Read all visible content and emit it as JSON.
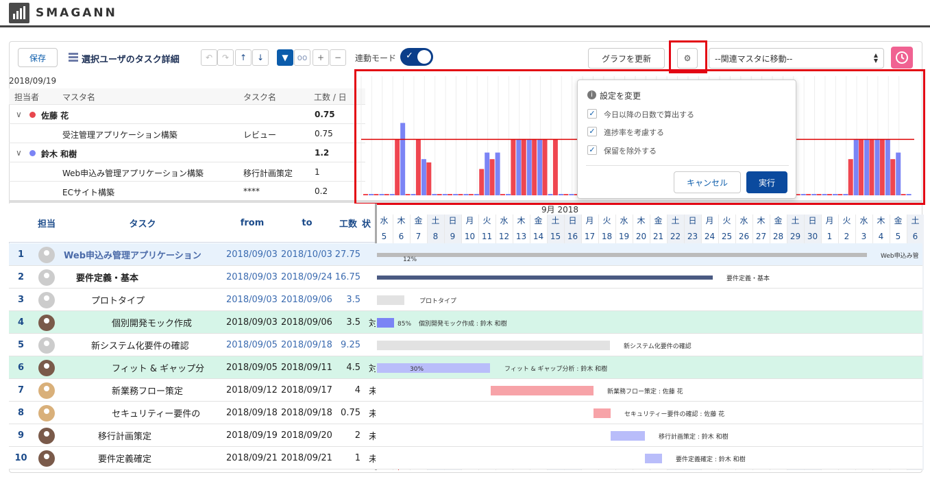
{
  "brand": {
    "name": "SMAGANN"
  },
  "toolbar": {
    "save_label": "保存",
    "title": "選択ユーザのタスク詳細",
    "sync_mode_label": "連動モード",
    "refresh_graph_label": "グラフを更新",
    "related_master_select": "--関連マスタに移動--"
  },
  "summary": {
    "date": "2018/09/19",
    "headers": [
      "担当者",
      "マスタ名",
      "タスク名",
      "工数 / 日"
    ],
    "rows": [
      {
        "type": "group",
        "name": "佐藤 花",
        "value": "0.75",
        "color": "#e8474e"
      },
      {
        "type": "item",
        "master": "受注管理アプリケーション構築",
        "task": "レビュー",
        "value": "0.75"
      },
      {
        "type": "group",
        "name": "鈴木 和樹",
        "value": "1.2",
        "color": "#7b84f5"
      },
      {
        "type": "item",
        "master": "Web申込み管理アプリケーション構築",
        "task": "移行計画策定",
        "value": "1"
      },
      {
        "type": "item",
        "master": "ECサイト構築",
        "task": "****",
        "value": "0.2"
      }
    ]
  },
  "settings_popup": {
    "title": "設定を変更",
    "options": [
      {
        "label": "今日以降の日数で算出する",
        "checked": true
      },
      {
        "label": "進捗率を考慮する",
        "checked": true
      },
      {
        "label": "保留を除外する",
        "checked": true
      }
    ],
    "cancel_label": "キャンセル",
    "execute_label": "実行"
  },
  "chart_data": {
    "type": "bar",
    "series": [
      {
        "values": [
          0,
          0,
          0,
          1.7,
          0,
          1.7,
          1.0,
          0,
          0,
          0,
          0,
          0.8,
          1.1,
          0,
          1.7,
          1.7,
          1.7,
          1.7,
          1.7,
          0,
          0,
          0,
          0,
          0,
          0,
          0,
          0,
          0,
          0,
          0,
          0,
          0,
          0,
          0,
          0,
          0,
          0,
          0,
          0,
          0,
          0,
          0,
          0,
          0,
          0,
          0,
          1.1,
          1.7,
          1.7,
          1.7,
          1.1,
          0
        ]
      },
      {
        "values": [
          0,
          0,
          0,
          2.2,
          0,
          1.1,
          0,
          0,
          0,
          0,
          0,
          1.3,
          1.3,
          0,
          1.7,
          1.7,
          1.7,
          0,
          0,
          0,
          0,
          0,
          0,
          0,
          0,
          0,
          0,
          0,
          0,
          0,
          0,
          0,
          0,
          0,
          0,
          0,
          0,
          0,
          0,
          0,
          0,
          0,
          0,
          0,
          0,
          0,
          1.7,
          1.7,
          1.7,
          1.7,
          1.3,
          0
        ]
      }
    ],
    "threshold": 1.7,
    "xlabel": "9月 2018"
  },
  "gantt": {
    "headers": [
      "担当",
      "タスク",
      "from",
      "to",
      "工数",
      "状"
    ],
    "month_label": "9月 2018",
    "days": [
      "水",
      "木",
      "金",
      "土",
      "日",
      "月",
      "火",
      "水",
      "木",
      "金",
      "土",
      "日",
      "月",
      "火",
      "水",
      "木",
      "金",
      "土",
      "日",
      "月",
      "火",
      "水",
      "木",
      "金",
      "土",
      "日",
      "月",
      "火",
      "水",
      "木",
      "金",
      "土"
    ],
    "dates": [
      "5",
      "6",
      "7",
      "8",
      "9",
      "10",
      "11",
      "12",
      "13",
      "14",
      "15",
      "16",
      "17",
      "18",
      "19",
      "20",
      "21",
      "22",
      "23",
      "24",
      "25",
      "26",
      "27",
      "28",
      "29",
      "30",
      "1",
      "2",
      "3",
      "4",
      "5",
      "6"
    ],
    "rows": [
      {
        "no": "1",
        "avatar": "none",
        "task": "Web申込み管理アプリケーション",
        "from": "2018/09/03",
        "to": "2018/10/03",
        "effort": "27.75",
        "status": "",
        "bar_label": "Web申込み管",
        "progress": "12%"
      },
      {
        "no": "2",
        "avatar": "none",
        "task": "要件定義・基本",
        "from": "2018/09/03",
        "to": "2018/09/24",
        "effort": "16.75",
        "status": "",
        "bar_label": "要件定義・基本",
        "progress": ""
      },
      {
        "no": "3",
        "avatar": "none",
        "task": "プロトタイプ",
        "from": "2018/09/03",
        "to": "2018/09/06",
        "effort": "3.5",
        "status": "",
        "bar_label": "プロトタイプ",
        "progress": ""
      },
      {
        "no": "4",
        "avatar": "m",
        "task": "個別開発モック作成",
        "from": "2018/09/03",
        "to": "2018/09/06",
        "effort": "3.5",
        "status": "対",
        "bar_label": "個別開発モック作成 : 鈴木 和樹",
        "progress": "85%"
      },
      {
        "no": "5",
        "avatar": "none",
        "task": "新システム化要件の確認",
        "from": "2018/09/05",
        "to": "2018/09/18",
        "effort": "9.25",
        "status": "",
        "bar_label": "新システム化要件の確認",
        "progress": ""
      },
      {
        "no": "6",
        "avatar": "m",
        "task": "フィット & ギャップ分",
        "from": "2018/09/05",
        "to": "2018/09/11",
        "effort": "4.5",
        "status": "対",
        "bar_label": "フィット & ギャップ分析 : 鈴木 和樹",
        "progress": "30%"
      },
      {
        "no": "7",
        "avatar": "f",
        "task": "新業務フロー策定",
        "from": "2018/09/12",
        "to": "2018/09/17",
        "effort": "4",
        "status": "未",
        "bar_label": "新業務フロー策定 : 佐藤 花",
        "progress": ""
      },
      {
        "no": "8",
        "avatar": "f",
        "task": "セキュリティー要件の",
        "from": "2018/09/18",
        "to": "2018/09/18",
        "effort": "0.75",
        "status": "未",
        "bar_label": "セキュリティー要件の確認 : 佐藤 花",
        "progress": ""
      },
      {
        "no": "9",
        "avatar": "m",
        "task": "移行計画策定",
        "from": "2018/09/19",
        "to": "2018/09/20",
        "effort": "2",
        "status": "未",
        "bar_label": "移行計画策定 : 鈴木 和樹",
        "progress": ""
      },
      {
        "no": "10",
        "avatar": "m",
        "task": "要件定義確定",
        "from": "2018/09/21",
        "to": "2018/09/21",
        "effort": "1",
        "status": "未",
        "bar_label": "要件定義確定 : 鈴木 和樹",
        "progress": ""
      }
    ]
  }
}
